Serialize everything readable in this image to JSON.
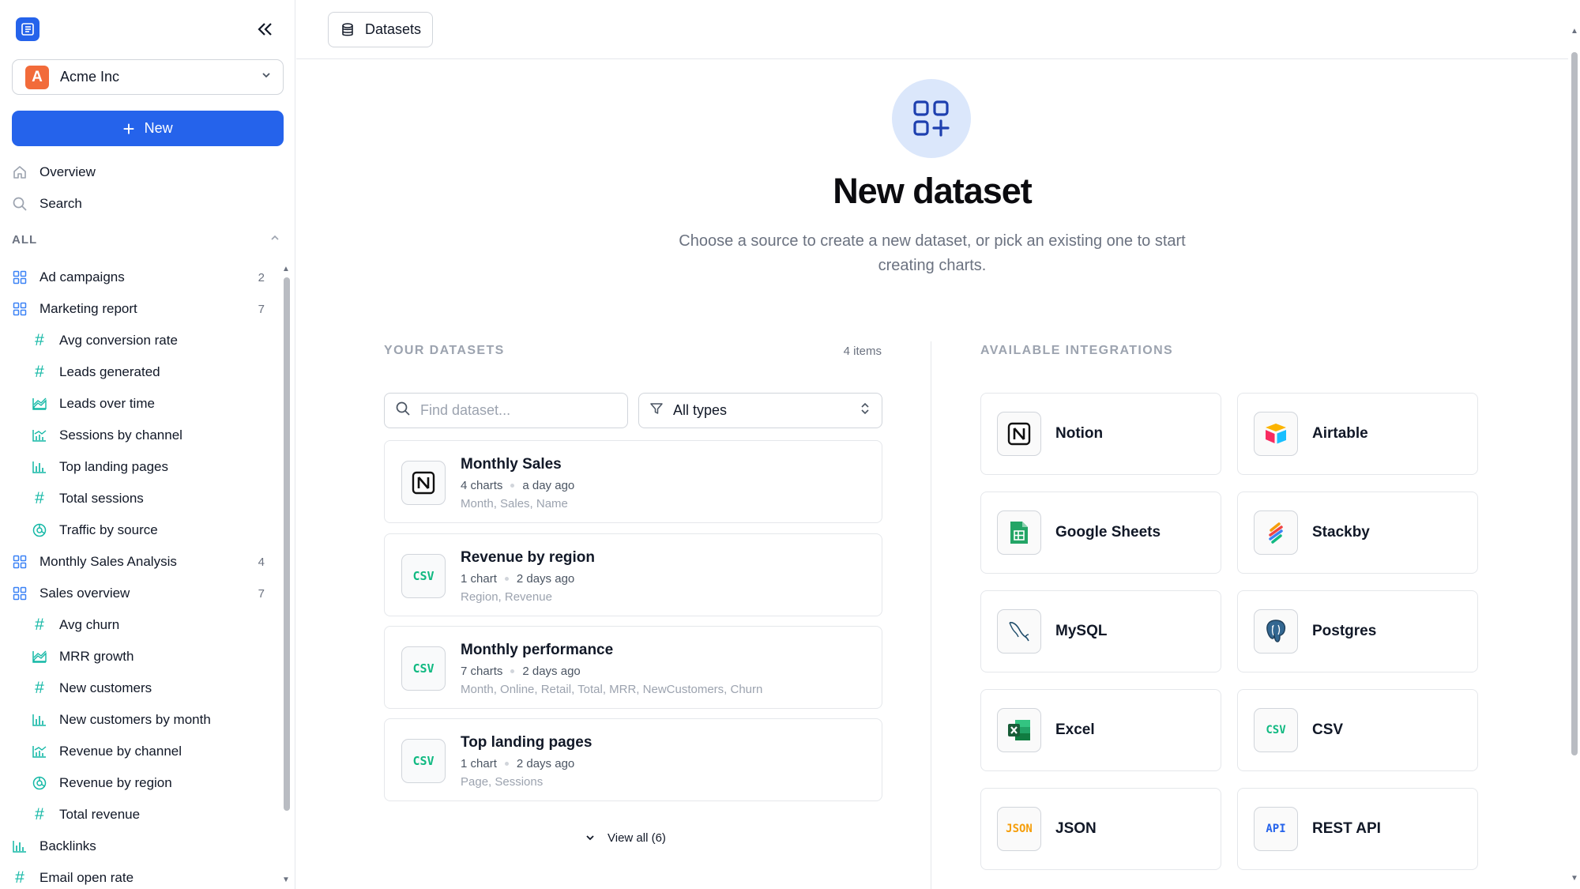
{
  "sidebar": {
    "workspace": {
      "initial": "A",
      "name": "Acme Inc"
    },
    "new_label": "New",
    "nav": [
      {
        "label": "Overview",
        "icon": "home-icon"
      },
      {
        "label": "Search",
        "icon": "search-icon"
      }
    ],
    "section_label": "ALL",
    "tree": [
      {
        "label": "Ad campaigns",
        "count": "2",
        "level": 0,
        "icon": "dashboard-icon"
      },
      {
        "label": "Marketing report",
        "count": "7",
        "level": 0,
        "icon": "dashboard-icon"
      },
      {
        "label": "Avg conversion rate",
        "level": 1,
        "icon": "number-icon"
      },
      {
        "label": "Leads generated",
        "level": 1,
        "icon": "number-icon"
      },
      {
        "label": "Leads over time",
        "level": 1,
        "icon": "area-chart-icon"
      },
      {
        "label": "Sessions by channel",
        "level": 1,
        "icon": "combo-chart-icon"
      },
      {
        "label": "Top landing pages",
        "level": 1,
        "icon": "bar-chart-icon"
      },
      {
        "label": "Total sessions",
        "level": 1,
        "icon": "number-icon"
      },
      {
        "label": "Traffic by source",
        "level": 1,
        "icon": "pie-chart-icon"
      },
      {
        "label": "Monthly Sales Analysis",
        "count": "4",
        "level": 0,
        "icon": "dashboard-icon"
      },
      {
        "label": "Sales overview",
        "count": "7",
        "level": 0,
        "icon": "dashboard-icon"
      },
      {
        "label": "Avg churn",
        "level": 1,
        "icon": "number-icon"
      },
      {
        "label": "MRR growth",
        "level": 1,
        "icon": "area-chart-icon"
      },
      {
        "label": "New customers",
        "level": 1,
        "icon": "number-icon"
      },
      {
        "label": "New customers by month",
        "level": 1,
        "icon": "bar-chart-icon"
      },
      {
        "label": "Revenue by channel",
        "level": 1,
        "icon": "combo-chart-icon"
      },
      {
        "label": "Revenue by region",
        "level": 1,
        "icon": "pie-chart-icon"
      },
      {
        "label": "Total revenue",
        "level": 1,
        "icon": "number-icon"
      },
      {
        "label": "Backlinks",
        "level": 0,
        "icon": "bar-chart-icon"
      },
      {
        "label": "Email open rate",
        "level": 0,
        "icon": "number-icon"
      }
    ]
  },
  "header": {
    "breadcrumb": "Datasets"
  },
  "hero": {
    "title": "New dataset",
    "subtitle": "Choose a source to create a new dataset, or pick an existing one to start creating charts."
  },
  "datasets": {
    "heading": "YOUR DATASETS",
    "count": "4 items",
    "search_placeholder": "Find dataset...",
    "type_filter": "All types",
    "view_all": "View all (6)",
    "items": [
      {
        "title": "Monthly Sales",
        "charts": "4 charts",
        "updated": "a day ago",
        "fields": "Month, Sales, Name",
        "icon": "notion"
      },
      {
        "title": "Revenue by region",
        "charts": "1 chart",
        "updated": "2 days ago",
        "fields": "Region, Revenue",
        "icon": "csv"
      },
      {
        "title": "Monthly performance",
        "charts": "7 charts",
        "updated": "2 days ago",
        "fields": "Month, Online, Retail, Total, MRR, NewCustomers, Churn",
        "icon": "csv"
      },
      {
        "title": "Top landing pages",
        "charts": "1 chart",
        "updated": "2 days ago",
        "fields": "Page, Sessions",
        "icon": "csv"
      }
    ]
  },
  "integrations": {
    "heading": "AVAILABLE INTEGRATIONS",
    "items": [
      {
        "name": "Notion",
        "icon": "notion-icon"
      },
      {
        "name": "Airtable",
        "icon": "airtable-icon"
      },
      {
        "name": "Google Sheets",
        "icon": "google-sheets-icon"
      },
      {
        "name": "Stackby",
        "icon": "stackby-icon"
      },
      {
        "name": "MySQL",
        "icon": "mysql-icon"
      },
      {
        "name": "Postgres",
        "icon": "postgres-icon"
      },
      {
        "name": "Excel",
        "icon": "excel-icon"
      },
      {
        "name": "CSV",
        "icon": "csv-icon",
        "glyph": "CSV"
      },
      {
        "name": "JSON",
        "icon": "json-icon",
        "glyph": "JSON"
      },
      {
        "name": "REST API",
        "icon": "rest-api-icon",
        "glyph": "API"
      }
    ]
  },
  "colors": {
    "accent": "#2563eb",
    "workspace_avatar": "#f26b3a",
    "teal_icon": "#14b8a6",
    "csv_green": "#10b981",
    "hero_bg": "#dbe7fb"
  }
}
